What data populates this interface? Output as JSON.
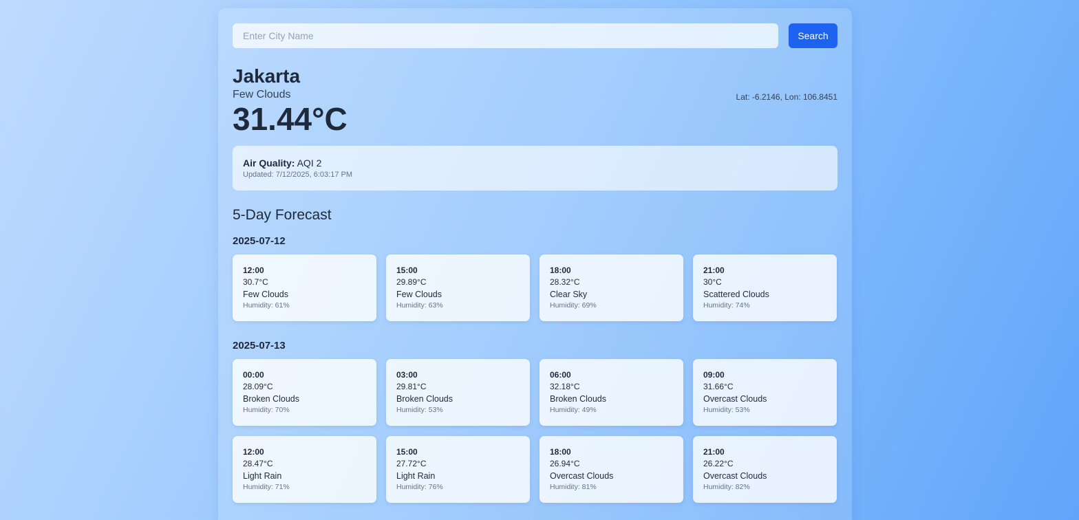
{
  "search": {
    "placeholder": "Enter City Name",
    "value": "",
    "button_label": "Search"
  },
  "current": {
    "city": "Jakarta",
    "condition": "Few Clouds",
    "temperature": "31.44°C",
    "coordinates": "Lat: -6.2146, Lon: 106.8451"
  },
  "air_quality": {
    "label": "Air Quality:",
    "value": "AQI 2",
    "updated": "Updated: 7/12/2025, 6:03:17 PM"
  },
  "forecast": {
    "title": "5-Day Forecast",
    "days": [
      {
        "date": "2025-07-12",
        "entries": [
          {
            "time": "12:00",
            "temp": "30.7°C",
            "desc": "Few Clouds",
            "humidity": "Humidity: 61%"
          },
          {
            "time": "15:00",
            "temp": "29.89°C",
            "desc": "Few Clouds",
            "humidity": "Humidity: 63%"
          },
          {
            "time": "18:00",
            "temp": "28.32°C",
            "desc": "Clear Sky",
            "humidity": "Humidity: 69%"
          },
          {
            "time": "21:00",
            "temp": "30°C",
            "desc": "Scattered Clouds",
            "humidity": "Humidity: 74%"
          }
        ]
      },
      {
        "date": "2025-07-13",
        "entries": [
          {
            "time": "00:00",
            "temp": "28.09°C",
            "desc": "Broken Clouds",
            "humidity": "Humidity: 70%"
          },
          {
            "time": "03:00",
            "temp": "29.81°C",
            "desc": "Broken Clouds",
            "humidity": "Humidity: 53%"
          },
          {
            "time": "06:00",
            "temp": "32.18°C",
            "desc": "Broken Clouds",
            "humidity": "Humidity: 49%"
          },
          {
            "time": "09:00",
            "temp": "31.66°C",
            "desc": "Overcast Clouds",
            "humidity": "Humidity: 53%"
          },
          {
            "time": "12:00",
            "temp": "28.47°C",
            "desc": "Light Rain",
            "humidity": "Humidity: 71%"
          },
          {
            "time": "15:00",
            "temp": "27.72°C",
            "desc": "Light Rain",
            "humidity": "Humidity: 76%"
          },
          {
            "time": "18:00",
            "temp": "26.94°C",
            "desc": "Overcast Clouds",
            "humidity": "Humidity: 81%"
          },
          {
            "time": "21:00",
            "temp": "26.22°C",
            "desc": "Overcast Clouds",
            "humidity": "Humidity: 82%"
          }
        ]
      }
    ]
  },
  "colors": {
    "accent": "#1d63f0",
    "background_start": "#bfdbfe",
    "background_end": "#60a5fa",
    "text": "#1e293b"
  }
}
